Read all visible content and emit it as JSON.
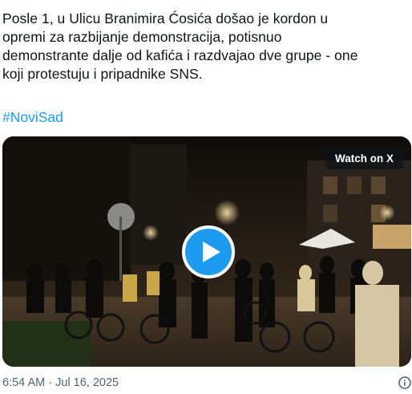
{
  "tweet": {
    "lines": [
      "Posle 1, u Ulicu Branimira Ćosića došao je kordon u",
      "opremi za razbijanje demonstracija, potisnuo",
      "demonstrante dalje od kafića i razdvajao dve grupe - one",
      "koji protestuju i pripadnike SNS."
    ],
    "hashtag": "#NoviSad"
  },
  "media": {
    "watch_label": "Watch on X",
    "play_icon": "play-icon",
    "accent": "#1d9bf0"
  },
  "meta": {
    "timestamp": "6:54 AM · Jul 16, 2025",
    "info_icon": "info-icon"
  },
  "colors": {
    "text": "#0f1419",
    "secondary": "#536471",
    "link": "#1d9bf0"
  }
}
